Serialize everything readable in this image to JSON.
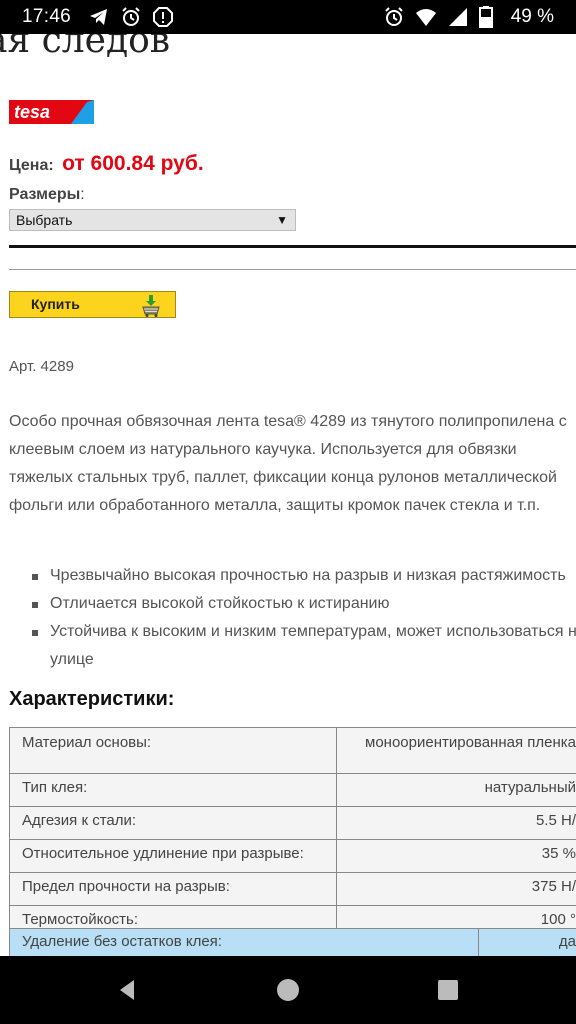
{
  "status_bar": {
    "time": "17:46",
    "battery": "49 %",
    "left_icons": [
      "telegram-icon",
      "alarm-icon",
      "alert-icon"
    ],
    "right_icons": [
      "alarm-icon",
      "wifi-icon",
      "signal-icon",
      "battery-icon"
    ]
  },
  "page": {
    "heading_fragment": "ая следов",
    "brand": "tesa",
    "price_label": "Цена:",
    "price_value": "от 600.84 руб.",
    "sizes_label": "Размеры",
    "sizes_colon": ":",
    "size_select_value": "Выбрать",
    "buy_label": "Купить",
    "article": "Арт. 4289",
    "description": "Особо прочная обвязочная лента tesa® 4289 из тянутого полипропилена с клеевым слоем из натурального каучука. Используется для обвязки тяжелых стальных труб, паллет, фиксации конца рулонов металлической фольги или обработанного металла, защиты кромок пачек стекла и т.п.",
    "features": [
      "Чрезвычайно высокая прочностью на разрыв и низкая растяжимость",
      "Отличается высокой стойкостью к истиранию",
      "Устойчива к высоким и низким температурам, может использоваться на улице"
    ],
    "characteristics_heading": "Характеристики:",
    "specs": [
      {
        "name": "Материал основы:",
        "value": "моноориентированная пленка"
      },
      {
        "name": "Тип клея:",
        "value": "натуральный"
      },
      {
        "name": "Адгезия к стали:",
        "value": "5.5 Н/"
      },
      {
        "name": "Относительное удлинение при разрыве:",
        "value": "35 %"
      },
      {
        "name": "Предел прочности на разрыв:",
        "value": "375 Н/"
      },
      {
        "name": "Термостойкость:",
        "value": "100 °"
      }
    ],
    "specs2": [
      {
        "name": "Удаление без остатков клея:",
        "value": "да"
      }
    ]
  },
  "colors": {
    "price": "#e30613",
    "buy_button": "#fcd41d",
    "logo_red": "#e30613",
    "logo_blue": "#1ea0e6",
    "spec_highlight": "#b8dff5"
  },
  "nav_bar": {
    "icons": [
      "back-icon",
      "home-icon",
      "recents-icon"
    ]
  }
}
